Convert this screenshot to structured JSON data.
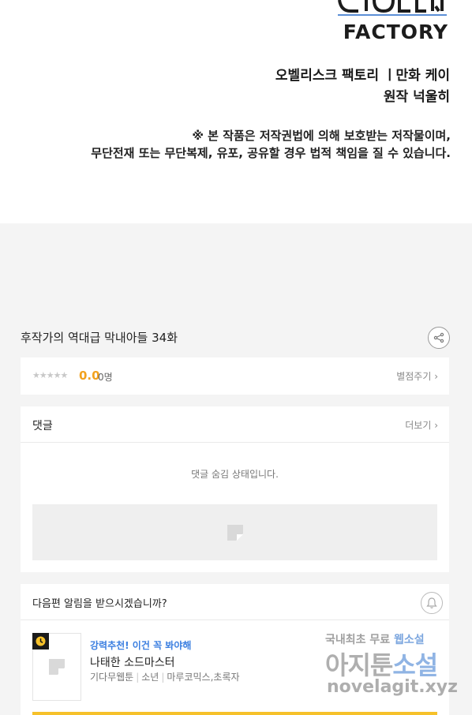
{
  "banner": {
    "logo_line1": "CIOLEM",
    "logo_line2": "FACTORY",
    "credit_line1": "오벨리스크 팩토리 ㅣ만화 케이",
    "credit_line2": "원작 넉울히",
    "notice_line1": "※ 본 작품은 저작권법에 의해 보호받는 저작물이며,",
    "notice_line2": "무단전재 또는 무단복제, 유포, 공유할 경우 법적 책임을 질 수 있습니다."
  },
  "episode": {
    "title": "후작가의 역대급 막내아들 34화",
    "share_icon": "share-icon"
  },
  "rating": {
    "stars": "★★★★★",
    "score": "0.0",
    "count": "0명",
    "rate_link": "별점주기 ›"
  },
  "comments": {
    "title": "댓글",
    "more": "더보기 ›",
    "hidden_message": "댓글 숨김 상태입니다."
  },
  "next_episode": {
    "title": "다음편 알림을 받으시겠습니까?",
    "bell_icon": "bell-icon"
  },
  "recommendation": {
    "tag": "강력추천! 이건 꼭 봐야해",
    "name": "나태한 소드마스터",
    "genre": "기다무웹툰",
    "category": "소년",
    "authors": "마루코믹스,초록자"
  },
  "watermark": {
    "line1_a": "국내최초 무료 ",
    "line1_b": "웹소설",
    "line2_a": "아지툰",
    "line2_b": "소설",
    "line3": "novelagit.xyz"
  },
  "colors": {
    "score": "#f2a21e",
    "recommend_tag": "#3a7ee0",
    "bottom_bar": "#f6c12a",
    "background": "#f4f4f4"
  }
}
